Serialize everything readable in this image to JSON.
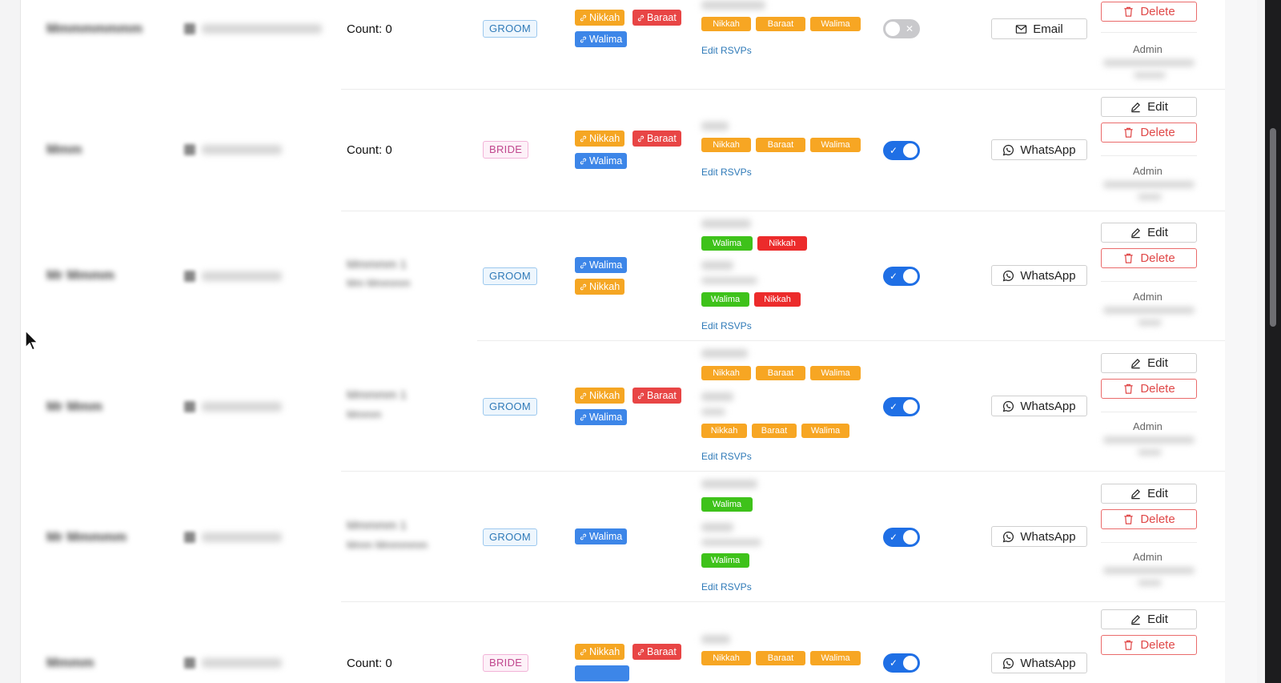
{
  "labels": {
    "count": "Count: 0",
    "edit_rsvps": "Edit RSVPs",
    "edit": "Edit",
    "delete": "Delete",
    "admin": "Admin",
    "email": "Email",
    "whatsapp": "WhatsApp"
  },
  "sides": {
    "groom": "GROOM",
    "bride": "BRIDE"
  },
  "events": {
    "nikkah": "Nikkah",
    "baraat": "Baraat",
    "walima": "Walima"
  },
  "colors": {
    "nikkah": "#f5a623",
    "baraat": "#e84545",
    "walima": "#3d86e8",
    "rsvp_attending": "#3ec21a",
    "rsvp_declined": "#ec2b2b",
    "rsvp_pending": "#f7a623",
    "toggle_on": "#1f6fe5",
    "link": "#2f7ab8"
  },
  "rows": [
    {
      "side": "GROOM",
      "sent": false,
      "contact": "Email"
    },
    {
      "side": "BRIDE",
      "sent": true,
      "contact": "WhatsApp"
    },
    {
      "side": "GROOM",
      "sent": true,
      "contact": "WhatsApp"
    },
    {
      "side": "GROOM",
      "sent": true,
      "contact": "WhatsApp"
    },
    {
      "side": "GROOM",
      "sent": true,
      "contact": "WhatsApp"
    },
    {
      "side": "BRIDE",
      "sent": true,
      "contact": "WhatsApp"
    }
  ]
}
